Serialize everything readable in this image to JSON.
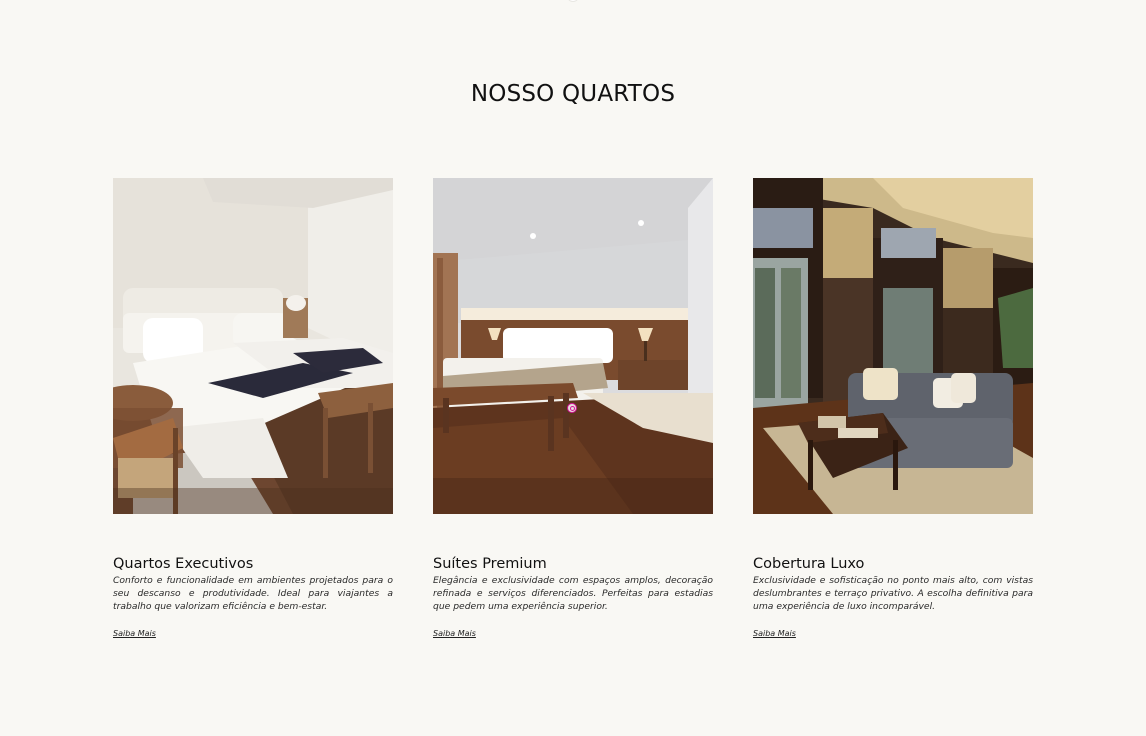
{
  "section": {
    "title": "NOSSO QUARTOS"
  },
  "rooms": [
    {
      "title": "Quartos Executivos",
      "description": "Conforto e funcionalidade em ambientes projetados para o seu descanso e produtividade. Ideal para viajantes a trabalho que valorizam eficiência e bem-estar.",
      "link_label": "Saiba Mais",
      "image": "hotel-room-twin-beds-photo"
    },
    {
      "title": "Suítes Premium",
      "description": "Elegância e exclusividade com espaços amplos, decoração refinada e serviços diferenciados. Perfeitas para estadias que pedem uma experiência superior.",
      "link_label": "Saiba Mais",
      "image": "hotel-suite-king-bed-photo"
    },
    {
      "title": "Cobertura Luxo",
      "description": "Exclusividade e sofisticação no ponto mais alto, com vistas deslumbrantes e terraço privativo. A escolha definitiva para uma experiência de luxo incomparável.",
      "link_label": "Saiba Mais",
      "image": "penthouse-living-room-photo"
    }
  ],
  "colors": {
    "background": "#f9f8f4",
    "text": "#111111",
    "cursor": "#d6179a"
  }
}
